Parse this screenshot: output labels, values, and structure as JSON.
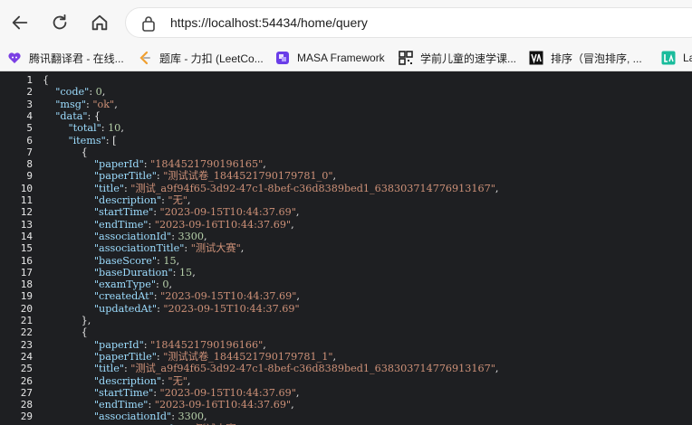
{
  "browser": {
    "url": "https://localhost:54434/home/query",
    "nav": {
      "back_icon": "back-arrow-icon",
      "reload_icon": "reload-icon",
      "home_icon": "home-icon"
    }
  },
  "bookmarks": [
    {
      "label": "腾讯翻译君 - 在线...",
      "icon": "tencent-translate-icon",
      "color": "#7b3fe4"
    },
    {
      "label": "题库 - 力扣 (LeetCo...",
      "icon": "leetcode-icon",
      "color": "#f0a030"
    },
    {
      "label": "MASA Framework",
      "icon": "masa-icon",
      "color": "#6a3de8"
    },
    {
      "label": "学前儿童的速学课...",
      "icon": "qr-icon",
      "color": "#222222"
    },
    {
      "label": "排序（冒泡排序, ...",
      "icon": "va-icon",
      "color": "#111111"
    },
    {
      "label": "La",
      "icon": "la-icon",
      "color": "#1abc9c"
    }
  ],
  "json_view": {
    "lines": [
      [
        [
          "p",
          "{"
        ]
      ],
      [
        [
          "p",
          "    "
        ],
        [
          "k",
          "\"code\""
        ],
        [
          "p",
          ": "
        ],
        [
          "n",
          "0"
        ],
        [
          "p",
          ","
        ]
      ],
      [
        [
          "p",
          "    "
        ],
        [
          "k",
          "\"msg\""
        ],
        [
          "p",
          ": "
        ],
        [
          "s",
          "\"ok\""
        ],
        [
          "p",
          ","
        ]
      ],
      [
        [
          "p",
          "    "
        ],
        [
          "k",
          "\"data\""
        ],
        [
          "p",
          ": {"
        ]
      ],
      [
        [
          "p",
          "        "
        ],
        [
          "k",
          "\"total\""
        ],
        [
          "p",
          ": "
        ],
        [
          "n",
          "10"
        ],
        [
          "p",
          ","
        ]
      ],
      [
        [
          "p",
          "        "
        ],
        [
          "k",
          "\"items\""
        ],
        [
          "p",
          ": ["
        ]
      ],
      [
        [
          "p",
          "            {"
        ]
      ],
      [
        [
          "p",
          "                "
        ],
        [
          "k",
          "\"paperId\""
        ],
        [
          "p",
          ": "
        ],
        [
          "s",
          "\"1844521790196165\""
        ],
        [
          "p",
          ","
        ]
      ],
      [
        [
          "p",
          "                "
        ],
        [
          "k",
          "\"paperTitle\""
        ],
        [
          "p",
          ": "
        ],
        [
          "s",
          "\"测试试卷_1844521790179781_0\""
        ],
        [
          "p",
          ","
        ]
      ],
      [
        [
          "p",
          "                "
        ],
        [
          "k",
          "\"title\""
        ],
        [
          "p",
          ": "
        ],
        [
          "s",
          "\"测试_a9f94f65-3d92-47c1-8bef-c36d8389bed1_638303714776913167\""
        ],
        [
          "p",
          ","
        ]
      ],
      [
        [
          "p",
          "                "
        ],
        [
          "k",
          "\"description\""
        ],
        [
          "p",
          ": "
        ],
        [
          "s",
          "\"无\""
        ],
        [
          "p",
          ","
        ]
      ],
      [
        [
          "p",
          "                "
        ],
        [
          "k",
          "\"startTime\""
        ],
        [
          "p",
          ": "
        ],
        [
          "s",
          "\"2023-09-15T10:44:37.69\""
        ],
        [
          "p",
          ","
        ]
      ],
      [
        [
          "p",
          "                "
        ],
        [
          "k",
          "\"endTime\""
        ],
        [
          "p",
          ": "
        ],
        [
          "s",
          "\"2023-09-16T10:44:37.69\""
        ],
        [
          "p",
          ","
        ]
      ],
      [
        [
          "p",
          "                "
        ],
        [
          "k",
          "\"associationId\""
        ],
        [
          "p",
          ": "
        ],
        [
          "n",
          "3300"
        ],
        [
          "p",
          ","
        ]
      ],
      [
        [
          "p",
          "                "
        ],
        [
          "k",
          "\"associationTitle\""
        ],
        [
          "p",
          ": "
        ],
        [
          "s",
          "\"测试大赛\""
        ],
        [
          "p",
          ","
        ]
      ],
      [
        [
          "p",
          "                "
        ],
        [
          "k",
          "\"baseScore\""
        ],
        [
          "p",
          ": "
        ],
        [
          "n",
          "15"
        ],
        [
          "p",
          ","
        ]
      ],
      [
        [
          "p",
          "                "
        ],
        [
          "k",
          "\"baseDuration\""
        ],
        [
          "p",
          ": "
        ],
        [
          "n",
          "15"
        ],
        [
          "p",
          ","
        ]
      ],
      [
        [
          "p",
          "                "
        ],
        [
          "k",
          "\"examType\""
        ],
        [
          "p",
          ": "
        ],
        [
          "n",
          "0"
        ],
        [
          "p",
          ","
        ]
      ],
      [
        [
          "p",
          "                "
        ],
        [
          "k",
          "\"createdAt\""
        ],
        [
          "p",
          ": "
        ],
        [
          "s",
          "\"2023-09-15T10:44:37.69\""
        ],
        [
          "p",
          ","
        ]
      ],
      [
        [
          "p",
          "                "
        ],
        [
          "k",
          "\"updatedAt\""
        ],
        [
          "p",
          ": "
        ],
        [
          "s",
          "\"2023-09-15T10:44:37.69\""
        ]
      ],
      [
        [
          "p",
          "            },"
        ]
      ],
      [
        [
          "p",
          "            {"
        ]
      ],
      [
        [
          "p",
          "                "
        ],
        [
          "k",
          "\"paperId\""
        ],
        [
          "p",
          ": "
        ],
        [
          "s",
          "\"1844521790196166\""
        ],
        [
          "p",
          ","
        ]
      ],
      [
        [
          "p",
          "                "
        ],
        [
          "k",
          "\"paperTitle\""
        ],
        [
          "p",
          ": "
        ],
        [
          "s",
          "\"测试试卷_1844521790179781_1\""
        ],
        [
          "p",
          ","
        ]
      ],
      [
        [
          "p",
          "                "
        ],
        [
          "k",
          "\"title\""
        ],
        [
          "p",
          ": "
        ],
        [
          "s",
          "\"测试_a9f94f65-3d92-47c1-8bef-c36d8389bed1_638303714776913167\""
        ],
        [
          "p",
          ","
        ]
      ],
      [
        [
          "p",
          "                "
        ],
        [
          "k",
          "\"description\""
        ],
        [
          "p",
          ": "
        ],
        [
          "s",
          "\"无\""
        ],
        [
          "p",
          ","
        ]
      ],
      [
        [
          "p",
          "                "
        ],
        [
          "k",
          "\"startTime\""
        ],
        [
          "p",
          ": "
        ],
        [
          "s",
          "\"2023-09-15T10:44:37.69\""
        ],
        [
          "p",
          ","
        ]
      ],
      [
        [
          "p",
          "                "
        ],
        [
          "k",
          "\"endTime\""
        ],
        [
          "p",
          ": "
        ],
        [
          "s",
          "\"2023-09-16T10:44:37.69\""
        ],
        [
          "p",
          ","
        ]
      ],
      [
        [
          "p",
          "                "
        ],
        [
          "k",
          "\"associationId\""
        ],
        [
          "p",
          ": "
        ],
        [
          "n",
          "3300"
        ],
        [
          "p",
          ","
        ]
      ],
      [
        [
          "p",
          "                "
        ],
        [
          "k",
          "\"associationTitle\""
        ],
        [
          "p",
          ": "
        ],
        [
          "s",
          "\"测试大赛\""
        ],
        [
          "p",
          ","
        ]
      ]
    ]
  }
}
